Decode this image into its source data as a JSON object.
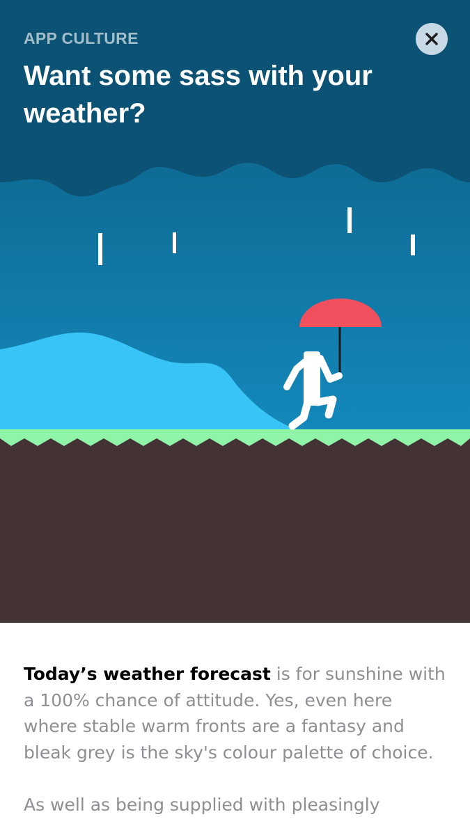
{
  "header": {
    "eyebrow": "APP CULTURE",
    "title": "Want some sass with your weather?"
  },
  "close_button": {
    "icon": "close-icon"
  },
  "article": {
    "lead": "Today’s weather forecast",
    "paragraph_1_rest": " is for sunshine with a 100% chance of attitude. Yes, even here where stable warm fronts are a fantasy and bleak grey is the sky's colour palette of choice.",
    "paragraph_2": "As well as being supplied with pleasingly"
  },
  "colors": {
    "sky_top": "#0a5a7e",
    "sky_bottom": "#1489bc",
    "hill": "#38c4f6",
    "grass": "#8ff3a8",
    "soil": "#433335",
    "umbrella": "#f0505e"
  }
}
